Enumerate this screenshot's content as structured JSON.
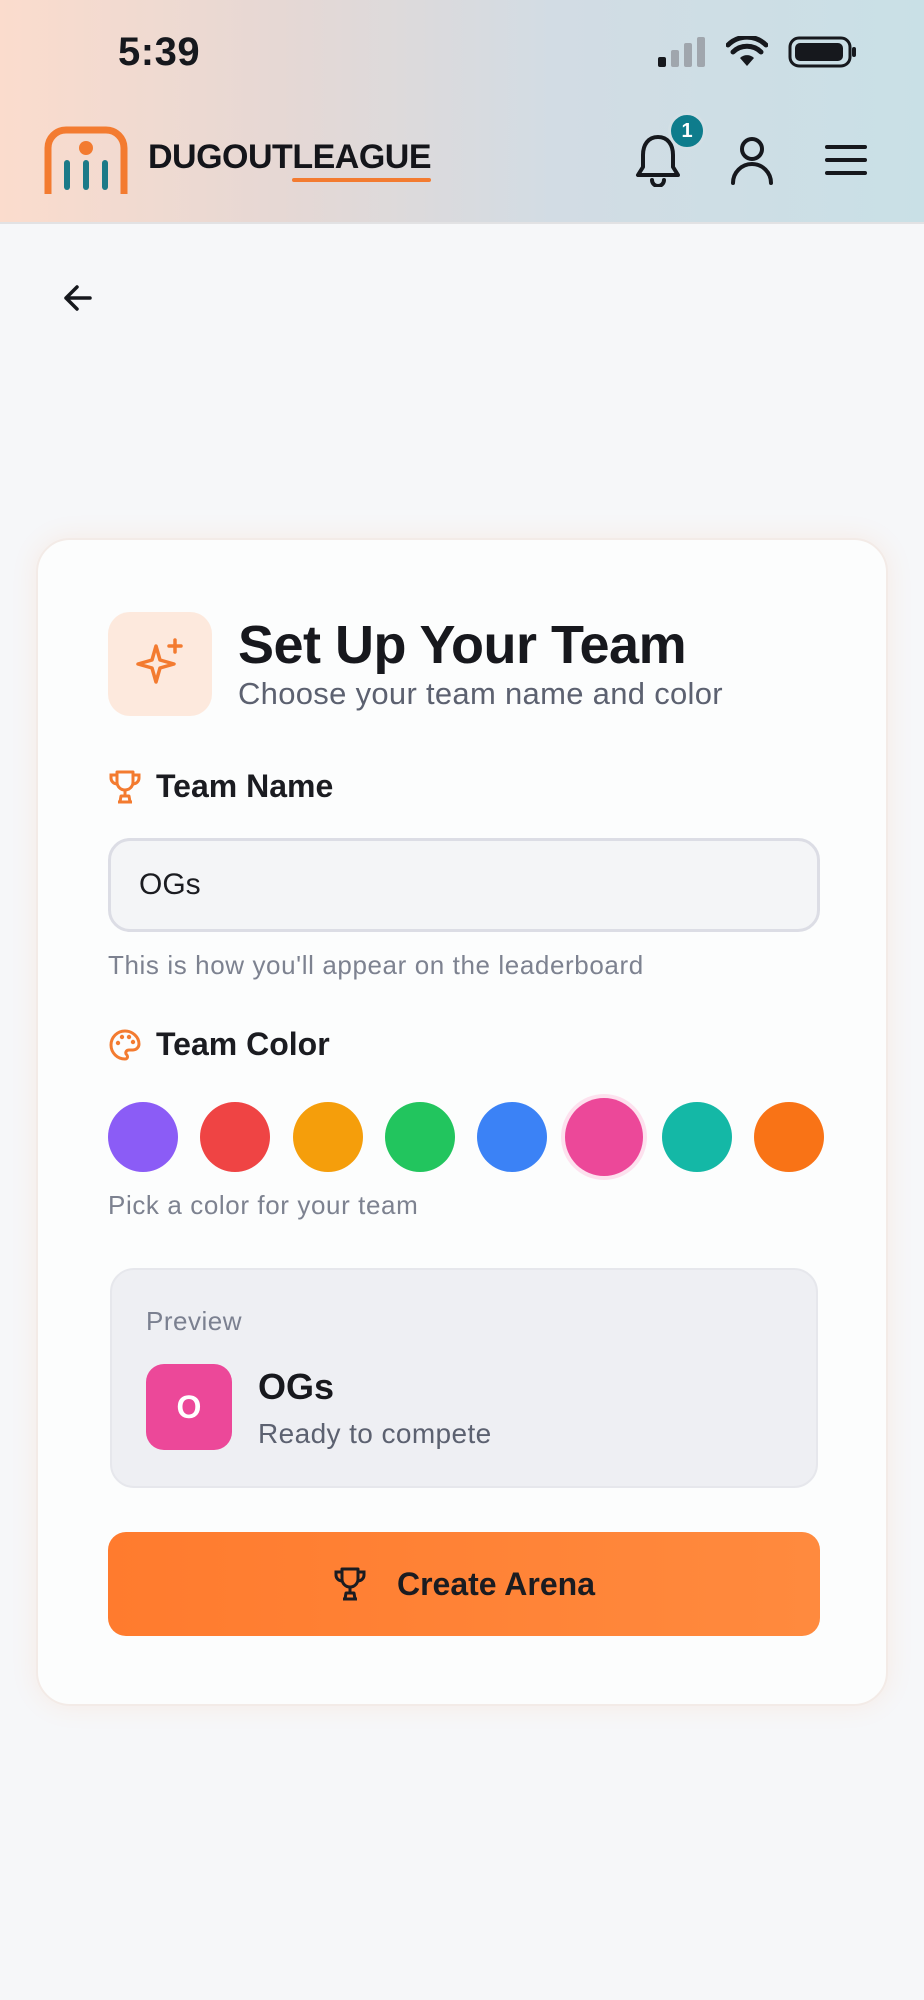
{
  "status_bar": {
    "time": "5:39"
  },
  "header": {
    "brand_dugout": "DUGOUT",
    "brand_league": "LEAGUE",
    "notification_count": "1"
  },
  "card": {
    "title": "Set Up Your Team",
    "subtitle": "Choose your team name and color",
    "team_name_label": "Team Name",
    "team_name_value": "OGs",
    "team_name_hint": "This is how you'll appear on the leaderboard",
    "team_color_label": "Team Color",
    "team_color_hint": "Pick a color for your team",
    "colors": [
      "#8b5cf6",
      "#ef4444",
      "#f59e0b",
      "#22c55e",
      "#3b82f6",
      "#ec4899",
      "#14b8a6",
      "#f97316"
    ],
    "selected_color": "#ec4899",
    "preview": {
      "label": "Preview",
      "initial": "O",
      "name": "OGs",
      "status": "Ready to compete"
    },
    "cta_label": "Create Arena"
  },
  "accent_color": "#f37b30"
}
